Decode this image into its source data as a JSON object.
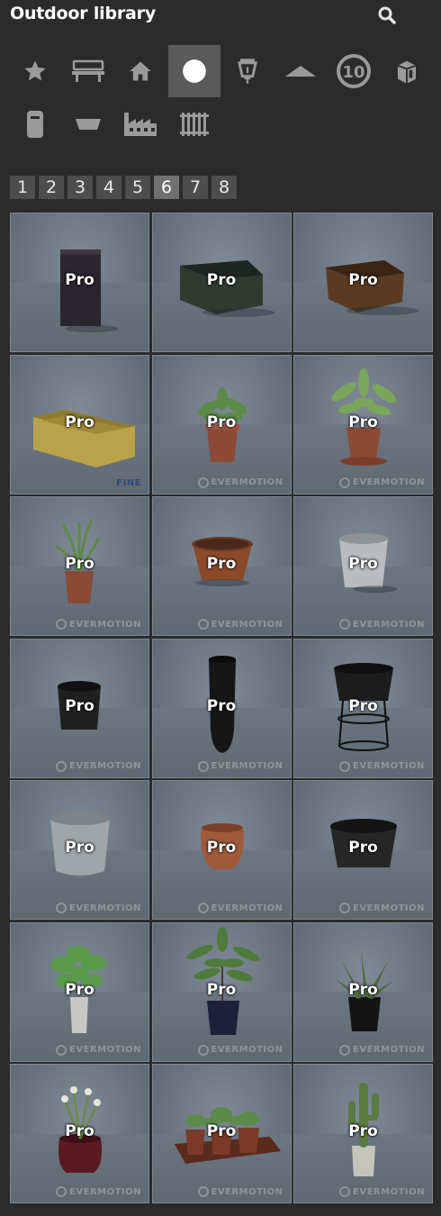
{
  "header": {
    "title": "Outdoor library",
    "search_icon": "search-icon"
  },
  "categories": [
    {
      "icon": "star-icon",
      "active": false
    },
    {
      "icon": "bench-icon",
      "active": false
    },
    {
      "icon": "house-icon",
      "active": false
    },
    {
      "icon": "circle-icon",
      "active": true
    },
    {
      "icon": "lantern-icon",
      "active": false
    },
    {
      "icon": "roof-icon",
      "active": false
    },
    {
      "icon": "badge-10-icon",
      "label": "10",
      "active": false
    },
    {
      "icon": "box-icon",
      "active": false
    },
    {
      "icon": "bin-icon",
      "active": false
    },
    {
      "icon": "tray-icon",
      "active": false
    },
    {
      "icon": "factory-icon",
      "active": false
    },
    {
      "icon": "fence-icon",
      "active": false
    }
  ],
  "pagination": {
    "pages": [
      "1",
      "2",
      "3",
      "4",
      "5",
      "6",
      "7",
      "8"
    ],
    "current": "6"
  },
  "items": [
    {
      "label": "Pro",
      "watermark": ""
    },
    {
      "label": "Pro",
      "watermark": ""
    },
    {
      "label": "Pro",
      "watermark": ""
    },
    {
      "label": "Pro",
      "watermark": "FINE"
    },
    {
      "label": "Pro",
      "watermark": "EVERMOTION"
    },
    {
      "label": "Pro",
      "watermark": "EVERMOTION"
    },
    {
      "label": "Pro",
      "watermark": "EVERMOTION"
    },
    {
      "label": "Pro",
      "watermark": "EVERMOTION"
    },
    {
      "label": "Pro",
      "watermark": "EVERMOTION"
    },
    {
      "label": "Pro",
      "watermark": "EVERMOTION"
    },
    {
      "label": "Pro",
      "watermark": "EVERMOTION"
    },
    {
      "label": "Pro",
      "watermark": "EVERMOTION"
    },
    {
      "label": "Pro",
      "watermark": "EVERMOTION"
    },
    {
      "label": "Pro",
      "watermark": "EVERMOTION"
    },
    {
      "label": "Pro",
      "watermark": "EVERMOTION"
    },
    {
      "label": "Pro",
      "watermark": "EVERMOTION"
    },
    {
      "label": "Pro",
      "watermark": "EVERMOTION"
    },
    {
      "label": "Pro",
      "watermark": "EVERMOTION"
    },
    {
      "label": "Pro",
      "watermark": "EVERMOTION"
    },
    {
      "label": "Pro",
      "watermark": "EVERMOTION"
    },
    {
      "label": "Pro",
      "watermark": "EVERMOTION"
    }
  ],
  "colors": {
    "background": "#2b2b2b",
    "icon": "#9a9a9a",
    "active_bg": "#5a5a5a",
    "tile_border": "#7e8792"
  }
}
